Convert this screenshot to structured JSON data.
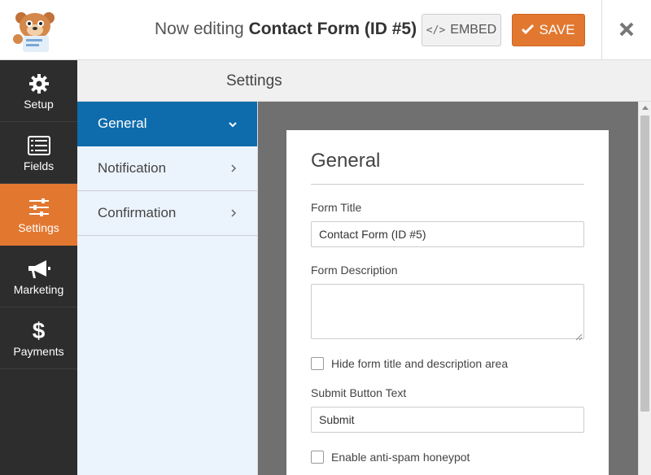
{
  "header": {
    "title_prefix": "Now editing ",
    "title_name": "Contact Form (ID #5)",
    "embed_label": "EMBED",
    "embed_icon": "code-icon",
    "save_label": "SAVE",
    "save_icon": "check-icon",
    "close_icon": "close-icon",
    "accent_color": "#e27730"
  },
  "leftnav": {
    "items": [
      {
        "label": "Setup",
        "icon": "gear-icon"
      },
      {
        "label": "Fields",
        "icon": "list-icon"
      },
      {
        "label": "Settings",
        "icon": "sliders-icon",
        "active": true
      },
      {
        "label": "Marketing",
        "icon": "megaphone-icon"
      },
      {
        "label": "Payments",
        "icon": "dollar-icon"
      }
    ]
  },
  "settings": {
    "header": "Settings",
    "subnav": [
      {
        "label": "General",
        "active": true
      },
      {
        "label": "Notification"
      },
      {
        "label": "Confirmation"
      }
    ]
  },
  "panel": {
    "title": "General",
    "form_title_label": "Form Title",
    "form_title_value": "Contact Form (ID #5)",
    "form_description_label": "Form Description",
    "form_description_value": "",
    "hide_title_label": "Hide form title and description area",
    "submit_text_label": "Submit Button Text",
    "submit_text_value": "Submit",
    "honeypot_label": "Enable anti-spam honeypot"
  }
}
